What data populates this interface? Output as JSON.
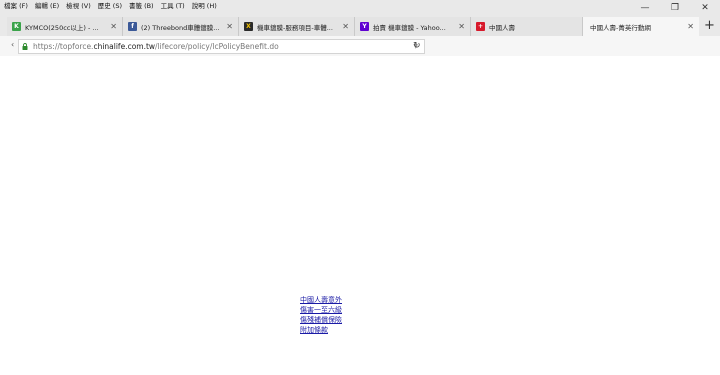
{
  "menubar": {
    "items": [
      "檔案 (F)",
      "編輯 (E)",
      "檢視 (V)",
      "歷史 (S)",
      "書籤 (B)",
      "工具 (T)",
      "說明 (H)"
    ]
  },
  "window_controls": {
    "minimize": "—",
    "restore": "❐",
    "close": "✕"
  },
  "tabs": [
    {
      "title": "KYMCO(250cc以上) - ...",
      "icon": "kymco-favicon",
      "color": "#3aa34a",
      "glyph": "K",
      "active": false
    },
    {
      "title": "(2) Threebond車體鍍膜...",
      "icon": "facebook-favicon",
      "color": "#3b5998",
      "glyph": "f",
      "active": false
    },
    {
      "title": "機車鍍膜-服務項目-車體...",
      "icon": "site-favicon",
      "color": "#2a2a2a",
      "glyph": "X",
      "active": false
    },
    {
      "title": "拍賣 機車鍍膜 - Yahoo...",
      "icon": "yahoo-favicon",
      "color": "#5f01d1",
      "glyph": "Y",
      "active": false
    },
    {
      "title": "中國人壽",
      "icon": "chinalife-favicon",
      "color": "#d7192b",
      "glyph": "+",
      "active": false
    },
    {
      "title": "中國人壽-菁英行動網",
      "icon": "",
      "color": "",
      "glyph": "",
      "active": true
    }
  ],
  "new_tab_glyph": "+",
  "address": {
    "url_prefix": "https://topforce.",
    "url_host": "chinalife.com.tw",
    "url_path": "/lifecore/policy/lcPolicyBenefit.do"
  },
  "page": {
    "links": [
      "中國人壽意外",
      "傷害一至六級",
      "傷殘補償保險",
      "附加條款"
    ]
  }
}
